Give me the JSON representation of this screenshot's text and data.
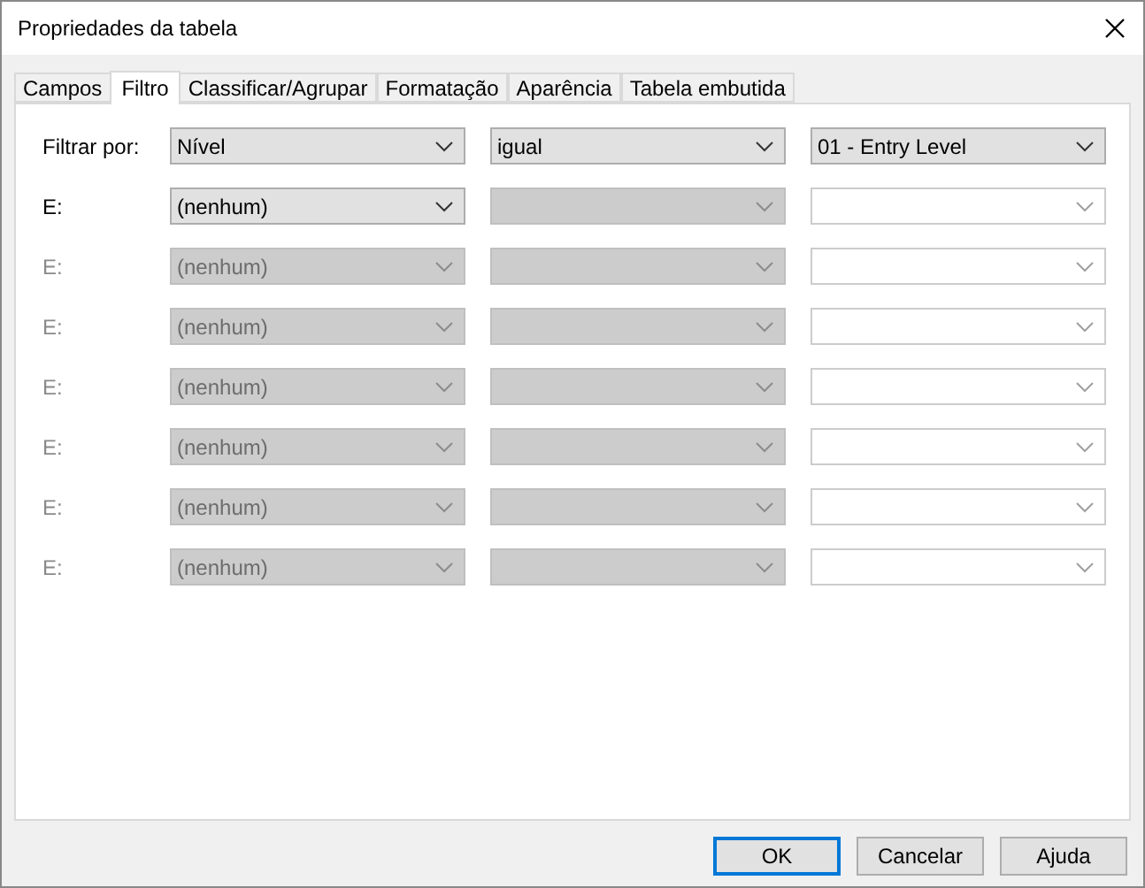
{
  "window": {
    "title": "Propriedades da tabela"
  },
  "tabs": [
    {
      "label": "Campos",
      "selected": false
    },
    {
      "label": "Filtro",
      "selected": true
    },
    {
      "label": "Classificar/Agrupar",
      "selected": false
    },
    {
      "label": "Formatação",
      "selected": false
    },
    {
      "label": "Aparência",
      "selected": false
    },
    {
      "label": "Tabela embutida",
      "selected": false
    }
  ],
  "filter_rows": [
    {
      "label": "Filtrar por:",
      "disabled": false,
      "fields": [
        {
          "kind": "dropdown",
          "value": "Nível",
          "disabled": false
        },
        {
          "kind": "dropdown",
          "value": "igual",
          "disabled": false
        },
        {
          "kind": "dropdown",
          "value": "01 - Entry Level",
          "disabled": false
        }
      ]
    },
    {
      "label": "E:",
      "disabled": false,
      "fields": [
        {
          "kind": "dropdown",
          "value": "(nenhum)",
          "disabled": false
        },
        {
          "kind": "dropdown",
          "disabled": true
        },
        {
          "kind": "editable",
          "disabled": true
        }
      ]
    },
    {
      "label": "E:",
      "disabled": true,
      "fields": [
        {
          "kind": "dropdown",
          "value": "(nenhum)",
          "disabled": true
        },
        {
          "kind": "dropdown",
          "disabled": true
        },
        {
          "kind": "editable",
          "disabled": true
        }
      ]
    },
    {
      "label": "E:",
      "disabled": true,
      "fields": [
        {
          "kind": "dropdown",
          "value": "(nenhum)",
          "disabled": true
        },
        {
          "kind": "dropdown",
          "disabled": true
        },
        {
          "kind": "editable",
          "disabled": true
        }
      ]
    },
    {
      "label": "E:",
      "disabled": true,
      "fields": [
        {
          "kind": "dropdown",
          "value": "(nenhum)",
          "disabled": true
        },
        {
          "kind": "dropdown",
          "disabled": true
        },
        {
          "kind": "editable",
          "disabled": true
        }
      ]
    },
    {
      "label": "E:",
      "disabled": true,
      "fields": [
        {
          "kind": "dropdown",
          "value": "(nenhum)",
          "disabled": true
        },
        {
          "kind": "dropdown",
          "disabled": true
        },
        {
          "kind": "editable",
          "disabled": true
        }
      ]
    },
    {
      "label": "E:",
      "disabled": true,
      "fields": [
        {
          "kind": "dropdown",
          "value": "(nenhum)",
          "disabled": true
        },
        {
          "kind": "dropdown",
          "disabled": true
        },
        {
          "kind": "editable",
          "disabled": true
        }
      ]
    },
    {
      "label": "E:",
      "disabled": true,
      "fields": [
        {
          "kind": "dropdown",
          "value": "(nenhum)",
          "disabled": true
        },
        {
          "kind": "dropdown",
          "disabled": true
        },
        {
          "kind": "editable",
          "disabled": true
        }
      ]
    }
  ],
  "buttons": [
    {
      "label": "OK",
      "default": true
    },
    {
      "label": "Cancelar",
      "default": false
    },
    {
      "label": "Ajuda",
      "default": false
    }
  ]
}
